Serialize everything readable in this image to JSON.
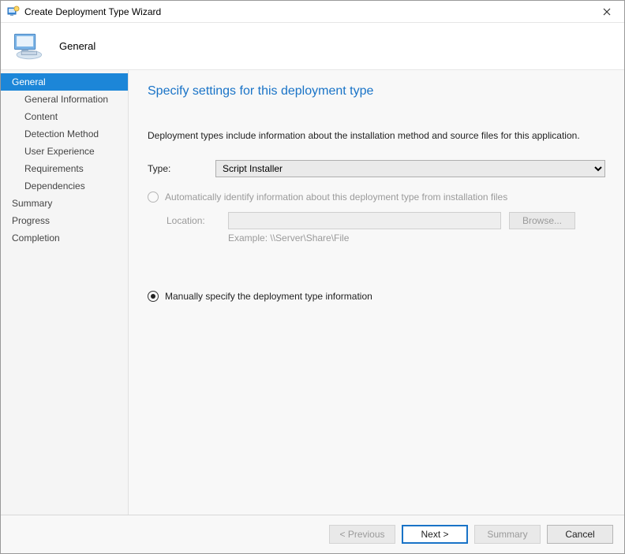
{
  "window": {
    "title": "Create Deployment Type Wizard",
    "banner": "General"
  },
  "sidebar": {
    "items": [
      {
        "label": "General",
        "indent": false,
        "active": true
      },
      {
        "label": "General Information",
        "indent": true,
        "active": false
      },
      {
        "label": "Content",
        "indent": true,
        "active": false
      },
      {
        "label": "Detection Method",
        "indent": true,
        "active": false
      },
      {
        "label": "User Experience",
        "indent": true,
        "active": false
      },
      {
        "label": "Requirements",
        "indent": true,
        "active": false
      },
      {
        "label": "Dependencies",
        "indent": true,
        "active": false
      },
      {
        "label": "Summary",
        "indent": false,
        "active": false
      },
      {
        "label": "Progress",
        "indent": false,
        "active": false
      },
      {
        "label": "Completion",
        "indent": false,
        "active": false
      }
    ]
  },
  "main": {
    "heading": "Specify settings for this deployment type",
    "description": "Deployment types include information about the installation method and source files for this application.",
    "type_label": "Type:",
    "type_value": "Script Installer",
    "radio_auto": "Automatically identify information about this deployment type from installation files",
    "location_label": "Location:",
    "location_value": "",
    "browse": "Browse...",
    "example": "Example: \\\\Server\\Share\\File",
    "radio_manual": "Manually specify the deployment type information"
  },
  "footer": {
    "previous": "< Previous",
    "next": "Next >",
    "summary": "Summary",
    "cancel": "Cancel"
  }
}
